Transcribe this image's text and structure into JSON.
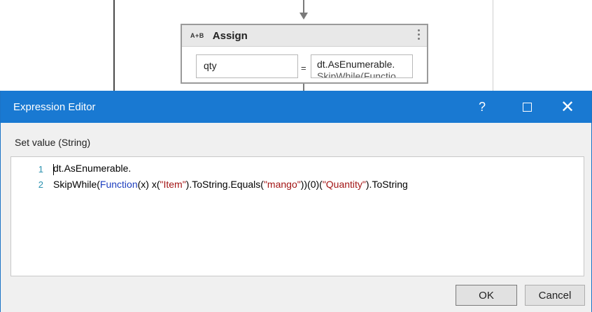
{
  "designer": {
    "activity": {
      "icon_text": "A+B",
      "title": "Assign",
      "to_value": "qty",
      "equals": "=",
      "value_line1": "dt.AsEnumerable.",
      "value_line2": "SkipWhile(Functio"
    }
  },
  "dialog": {
    "title": "Expression Editor",
    "help_label": "?",
    "close_label": "✕",
    "set_value_label": "Set value (String)",
    "editor": {
      "lines": [
        {
          "number": "1",
          "tokens": [
            {
              "text": "dt.AsEnumerable.",
              "type": "plain"
            }
          ]
        },
        {
          "number": "2",
          "tokens": [
            {
              "text": "SkipWhile(",
              "type": "plain"
            },
            {
              "text": "Function",
              "type": "keyword"
            },
            {
              "text": "(x) x(",
              "type": "plain"
            },
            {
              "text": "\"Item\"",
              "type": "string"
            },
            {
              "text": ").ToString.Equals(",
              "type": "plain"
            },
            {
              "text": "\"mango\"",
              "type": "string"
            },
            {
              "text": "))(0)(",
              "type": "plain"
            },
            {
              "text": "\"Quantity\"",
              "type": "string"
            },
            {
              "text": ").ToString",
              "type": "plain"
            }
          ]
        }
      ]
    },
    "buttons": {
      "ok": "OK",
      "cancel": "Cancel"
    }
  },
  "colors": {
    "titlebar": "#1979d2",
    "keyword": "#1e3fbf",
    "string": "#a31515",
    "line_number": "#2b91af"
  }
}
